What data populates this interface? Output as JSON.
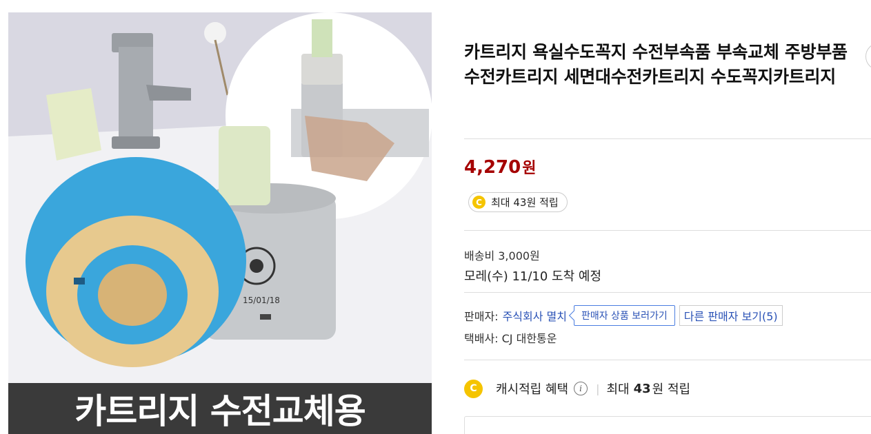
{
  "image": {
    "banner_text": "카트리지 수전교체용"
  },
  "product": {
    "title": "카트리지 욕실수도꼭지 수전부속품 부속교체 주방부품 수전카트리지 세면대수전카트리지 수도꼭지카트리지",
    "price_amount": "4,270",
    "price_unit": "원",
    "price_color": "#a50000"
  },
  "reward_chip": {
    "coin_icon": "C",
    "text": "최대 43원 적립"
  },
  "shipping": {
    "fee": "배송비 3,000원",
    "arrival": "모레(수) 11/10 도착 예정"
  },
  "seller": {
    "label": "판매자:",
    "name": "주식회사 멸치",
    "view_products_label": "판매자 상품 보러가기",
    "other_sellers_label": "다른 판매자 보기(5)"
  },
  "courier": {
    "label": "택배사: CJ 대한통운"
  },
  "cash_benefit": {
    "coin_icon": "C",
    "label": "캐시적립 혜택",
    "info_icon": "i",
    "separator": "|",
    "max_prefix": "최대",
    "max_amount": "43",
    "max_suffix": "원 적립"
  },
  "colors": {
    "accent_link": "#2a52b6",
    "coin": "#f5c400",
    "banner_bg": "#3a3a3a"
  }
}
